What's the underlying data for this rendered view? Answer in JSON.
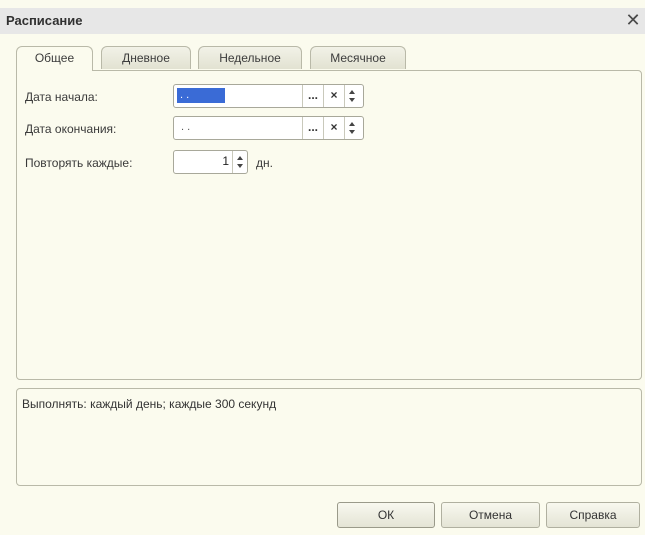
{
  "window": {
    "title": "Расписание",
    "close_icon": "close-icon"
  },
  "tabs": [
    {
      "label": "Общее"
    },
    {
      "label": "Дневное"
    },
    {
      "label": "Недельное"
    },
    {
      "label": "Месячное"
    }
  ],
  "form": {
    "start_date": {
      "label": "Дата начала:",
      "value": " .  . "
    },
    "end_date": {
      "label": "Дата окончания:",
      "value": " .  . "
    },
    "repeat": {
      "label": "Повторять каждые:",
      "value": "1",
      "unit": "дн."
    },
    "select_button": "...",
    "clear_button": "×"
  },
  "description": {
    "text": "Выполнять: каждый день; каждые 300 секунд"
  },
  "buttons": {
    "ok": "ОК",
    "cancel": "Отмена",
    "help": "Справка"
  },
  "colors": {
    "selection": "#3a6bd6",
    "background": "#fbfbee"
  }
}
